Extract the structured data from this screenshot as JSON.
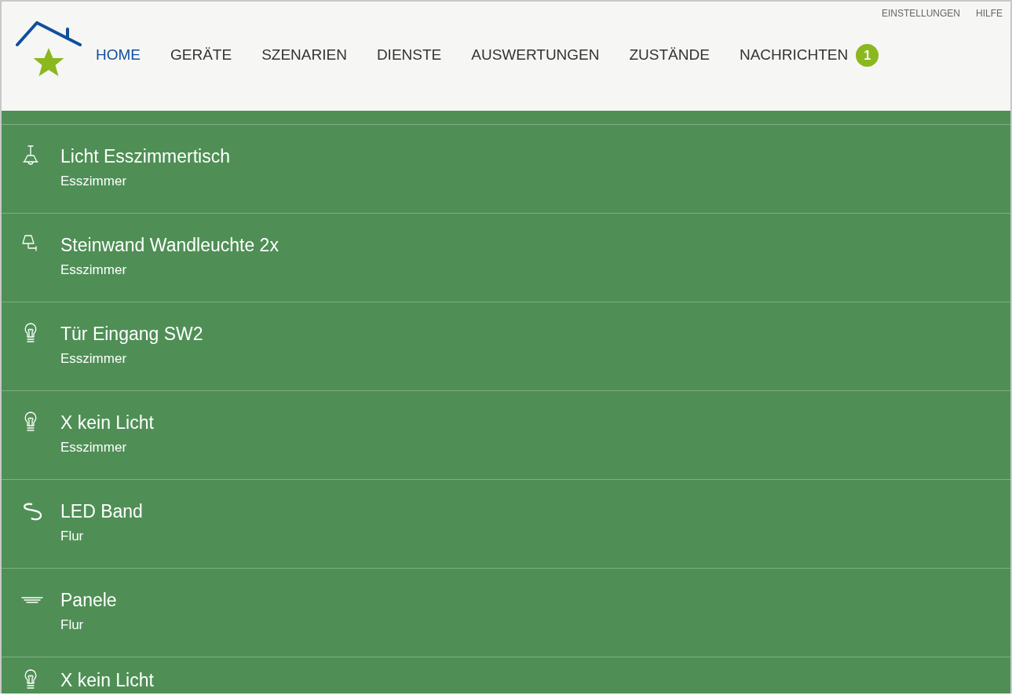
{
  "top_links": [
    "EINSTELLUNGEN",
    "HILFE"
  ],
  "nav": [
    {
      "label": "HOME",
      "selected": true
    },
    {
      "label": "GERÄTE",
      "selected": false
    },
    {
      "label": "SZENARIEN",
      "selected": false
    },
    {
      "label": "DIENSTE",
      "selected": false
    },
    {
      "label": "AUSWERTUNGEN",
      "selected": false
    },
    {
      "label": "ZUSTÄNDE",
      "selected": false
    },
    {
      "label": "NACHRICHTEN",
      "selected": false,
      "badge": "1"
    }
  ],
  "devices": [
    {
      "kind": "pendant",
      "name": "Licht Esszimmertisch",
      "room": "Esszimmer"
    },
    {
      "kind": "wall",
      "name": "Steinwand Wandleuchte 2x",
      "room": "Esszimmer"
    },
    {
      "kind": "bulb",
      "name": "Tür Eingang SW2",
      "room": "Esszimmer"
    },
    {
      "kind": "bulb",
      "name": "X kein Licht",
      "room": "Esszimmer"
    },
    {
      "kind": "strip",
      "name": "LED Band",
      "room": "Flur"
    },
    {
      "kind": "panel",
      "name": "Panele",
      "room": "Flur"
    },
    {
      "kind": "bulb",
      "name": "X kein Licht"
    }
  ]
}
